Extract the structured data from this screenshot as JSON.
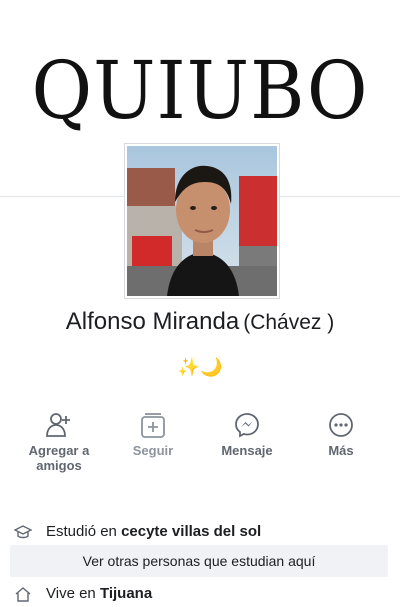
{
  "masthead": {
    "title": "QUIUBO"
  },
  "profile": {
    "name": "Alfonso Miranda",
    "alternate_name": "(Chávez )",
    "bio": "✨🌙"
  },
  "actions": [
    {
      "label_line1": "Agregar a",
      "label_line2": "amigos",
      "icon": "add-friend-icon"
    },
    {
      "label": "Seguir",
      "icon": "follow-icon"
    },
    {
      "label": "Mensaje",
      "icon": "messenger-icon"
    },
    {
      "label": "Más",
      "icon": "more-icon"
    }
  ],
  "info": {
    "education": {
      "prefix": "Estudió en",
      "value": "cecyte villas del sol",
      "icon": "graduation-cap-icon"
    },
    "see_others_label": "Ver otras personas que estudian aquí",
    "residence": {
      "prefix": "Vive en",
      "value": "Tijuana",
      "icon": "home-icon"
    }
  },
  "colors": {
    "label_gray": "#606770",
    "muted_gray": "#8d949e",
    "text": "#1c1e21",
    "chip_bg": "#f0f2f5"
  }
}
